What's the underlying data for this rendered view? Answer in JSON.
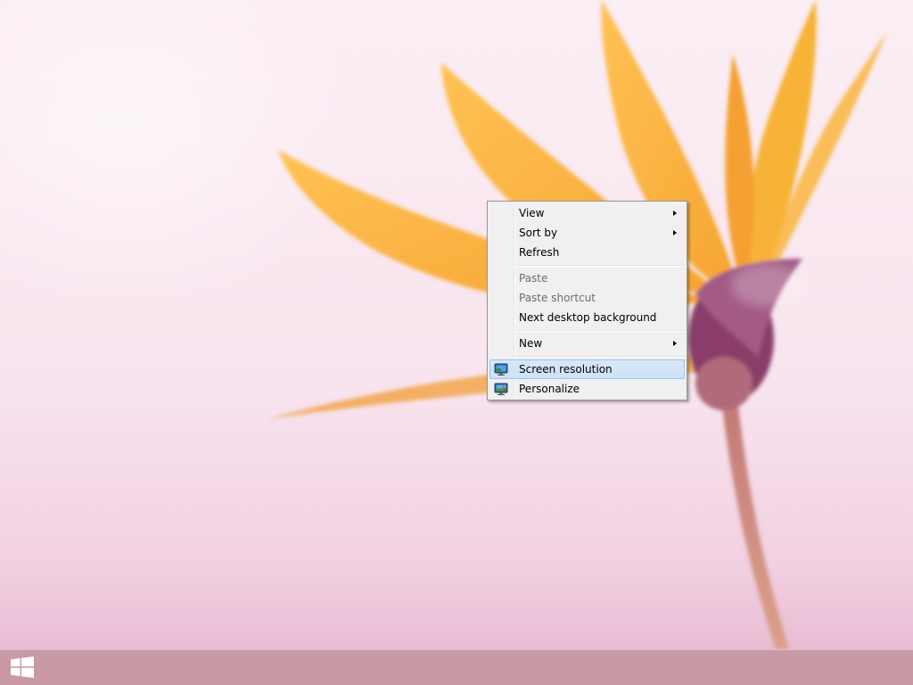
{
  "context_menu": {
    "items": [
      {
        "label": "View",
        "submenu": true,
        "enabled": true
      },
      {
        "label": "Sort by",
        "submenu": true,
        "enabled": true
      },
      {
        "label": "Refresh",
        "submenu": false,
        "enabled": true
      },
      {
        "label": "Paste",
        "submenu": false,
        "enabled": false
      },
      {
        "label": "Paste shortcut",
        "submenu": false,
        "enabled": false
      },
      {
        "label": "Next desktop background",
        "submenu": false,
        "enabled": true
      },
      {
        "label": "New",
        "submenu": true,
        "enabled": true
      },
      {
        "label": "Screen resolution",
        "submenu": false,
        "enabled": true,
        "highlighted": true,
        "icon": "screen-resolution-icon"
      },
      {
        "label": "Personalize",
        "submenu": false,
        "enabled": true,
        "icon": "personalize-icon"
      }
    ]
  },
  "taskbar": {
    "start_icon": "windows-logo-icon"
  },
  "colors": {
    "menu_background": "#f0f0f0",
    "highlight": "#cde2f6",
    "taskbar": "#c4929e",
    "petal": "#f6b23a"
  }
}
